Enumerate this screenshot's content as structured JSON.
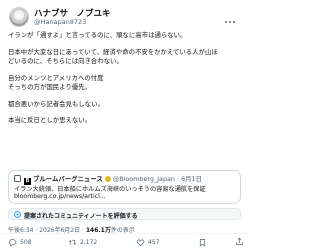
{
  "author": {
    "name": "ハナブサ　ノブユキ",
    "handle": "@Hanapan8723"
  },
  "tweet": {
    "lines": [
      "イランが「通すよ」と言ってるのに、頑なに高市は通らない。",
      "",
      "日本中が大変な日にあっていて、経済や命の不安をかかえている人が山ほ",
      "どいるのに、そちらには向き合わない。",
      "",
      "自分のメンツとアメリカへの忖度",
      "そっちの方が国民より優先。",
      "",
      "都合悪いから記者会見もしない。",
      "",
      "本当に反日としか思えない。"
    ]
  },
  "quoted_card": {
    "source": "ブルームバーグニュース",
    "handle": "@Bloomberg_Japan",
    "date": "· 6月1日",
    "text": "イラン大統領、日本船にホルムズ海峡のいっそうの容易な通航を保証",
    "url": "bloomberg.co.jp/news/articl...",
    "logo_letter": "B"
  },
  "community_note": {
    "label": "提案されたコミュニティノートを評価する"
  },
  "meta": {
    "time_date": "午後6:34 · 2026年6月2日 ·",
    "views": "146.1万",
    "views_label": "件の表示"
  },
  "actions": {
    "replies": "508",
    "reposts": "2,172",
    "likes": "457"
  },
  "colors": {
    "accent": "#1d9bf0",
    "text": "#0f1419",
    "muted": "#536471",
    "verified": "#e2b719"
  }
}
